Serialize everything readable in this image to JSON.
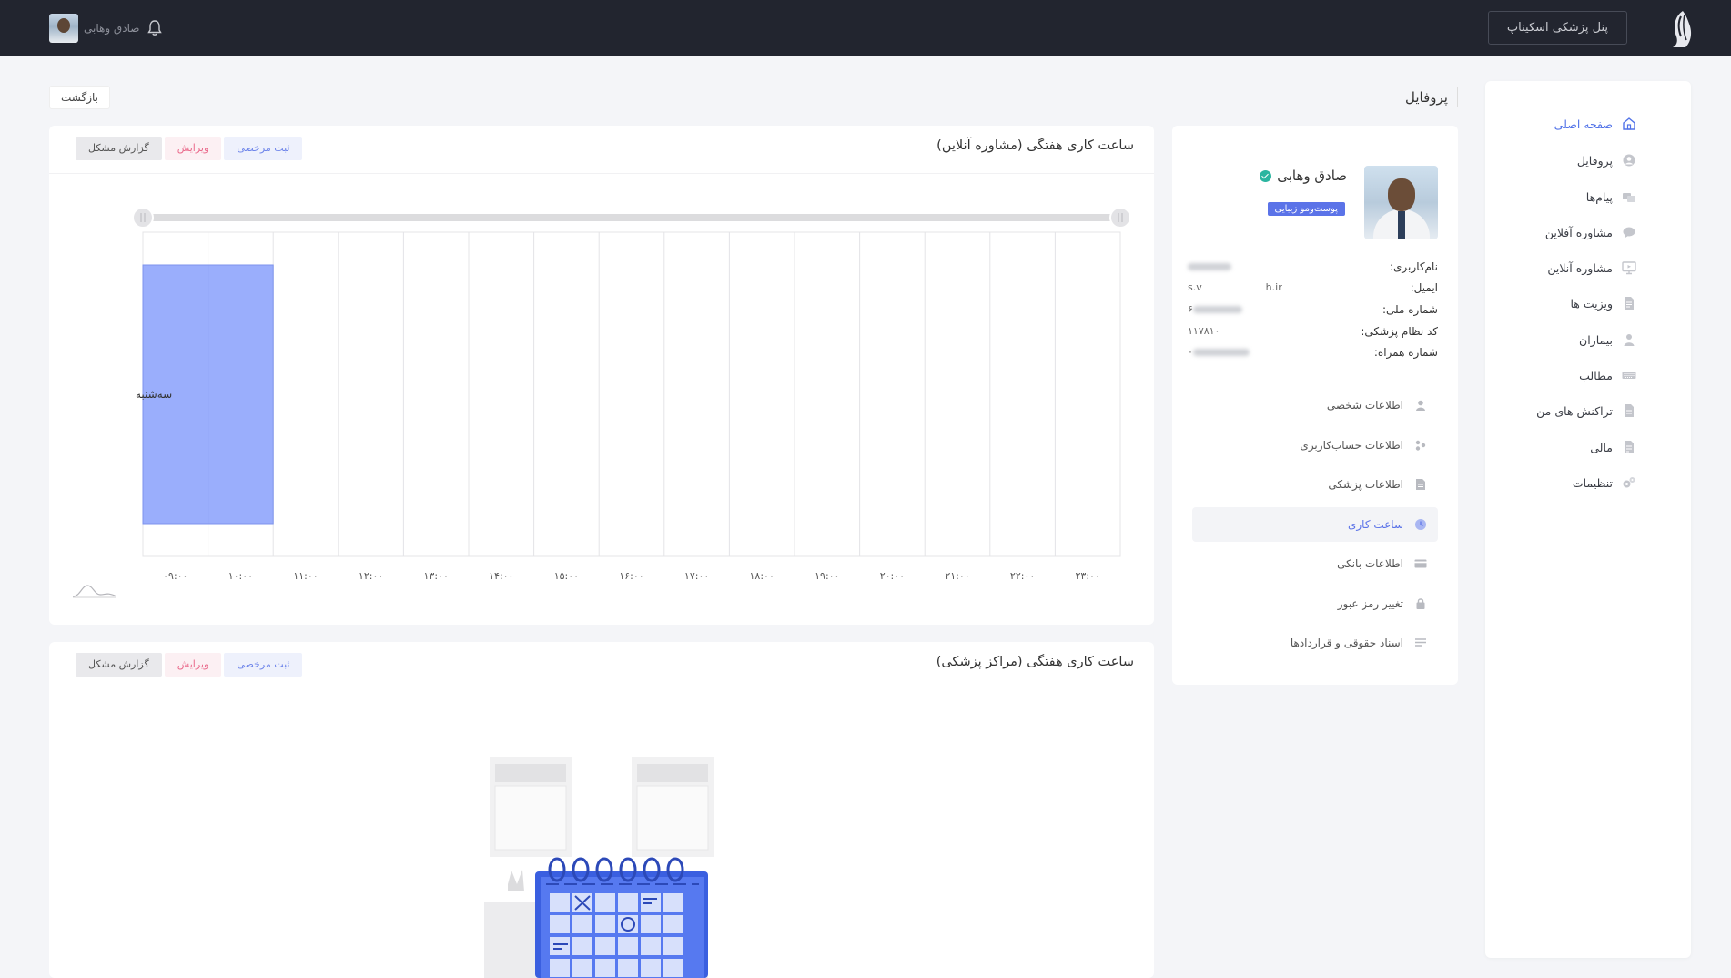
{
  "topbar": {
    "panel_button": "پنل پزشکی اسکیناپ",
    "user_name": "صادق وهابی"
  },
  "sidebar": {
    "items": [
      {
        "label": "صفحه اصلی",
        "icon": "home-icon",
        "active": true
      },
      {
        "label": "پروفایل",
        "icon": "user-circle-icon"
      },
      {
        "label": "پیام‌ها",
        "icon": "messages-icon"
      },
      {
        "label": "مشاوره آفلاین",
        "icon": "chat-icon"
      },
      {
        "label": "مشاوره آنلاین",
        "icon": "monitor-icon"
      },
      {
        "label": "ویزیت ها",
        "icon": "document-icon"
      },
      {
        "label": "بیماران",
        "icon": "patient-icon"
      },
      {
        "label": "مطالب",
        "icon": "keyboard-icon"
      },
      {
        "label": "تراکنش های من",
        "icon": "receipt-icon"
      },
      {
        "label": "مالی",
        "icon": "finance-icon"
      },
      {
        "label": "تنظیمات",
        "icon": "gears-icon"
      }
    ]
  },
  "page": {
    "title": "پروفایل",
    "back_label": "بازگشت"
  },
  "profile": {
    "name": "صادق وهابی",
    "specialty": "پوست‌ومو زیبایی",
    "info": [
      {
        "label": "نام‌کاربری:",
        "value": ""
      },
      {
        "label": "ایمیل:",
        "value": "s.v                    h.ir"
      },
      {
        "label": "شماره ملی:",
        "value": "۶"
      },
      {
        "label": "کد نظام پزشکی:",
        "value": "۱۱۷۸۱۰"
      },
      {
        "label": "شماره همراه:",
        "value": "۰"
      }
    ],
    "menu": [
      {
        "label": "اطلاعات شخصی",
        "icon": "person-icon"
      },
      {
        "label": "اطلاعات حساب‌کاربری",
        "icon": "account-icon"
      },
      {
        "label": "اطلاعات پزشکی",
        "icon": "medical-doc-icon"
      },
      {
        "label": "ساعت کاری",
        "icon": "clock-icon",
        "active": true
      },
      {
        "label": "اطلاعات بانکی",
        "icon": "bank-card-icon"
      },
      {
        "label": "تغییر رمز عبور",
        "icon": "lock-icon"
      },
      {
        "label": "اسناد حقوقی و قراردادها",
        "icon": "contracts-icon"
      }
    ]
  },
  "weekly_online": {
    "title": "ساعت کاری هفتگی (مشاوره آنلاین)",
    "buttons": {
      "leave": "ثبت مرخصی",
      "edit": "ویرایش",
      "report": "گزارش مشکل"
    }
  },
  "weekly_centers": {
    "title": "ساعت کاری هفتگی (مراکز پزشکی)",
    "buttons": {
      "leave": "ثبت مرخصی",
      "edit": "ویرایش",
      "report": "گزارش مشکل"
    }
  },
  "chart_data": {
    "type": "bar",
    "orientation": "horizontal-timeline",
    "categories": [
      "سه‌شنبه"
    ],
    "x_ticks": [
      "۰۹:۰۰",
      "۱۰:۰۰",
      "۱۱:۰۰",
      "۱۲:۰۰",
      "۱۳:۰۰",
      "۱۴:۰۰",
      "۱۵:۰۰",
      "۱۶:۰۰",
      "۱۷:۰۰",
      "۱۸:۰۰",
      "۱۹:۰۰",
      "۲۰:۰۰",
      "۲۱:۰۰",
      "۲۲:۰۰",
      "۲۳:۰۰"
    ],
    "xlim": [
      9,
      24
    ],
    "series": [
      {
        "segments": [
          {
            "category": "سه‌شنبه",
            "start": 9,
            "end": 10
          },
          {
            "category": "سه‌شنبه",
            "start": 10,
            "end": 11
          }
        ]
      }
    ],
    "color": "#9aaefc",
    "grid": true,
    "range_slider": [
      9,
      24
    ]
  }
}
